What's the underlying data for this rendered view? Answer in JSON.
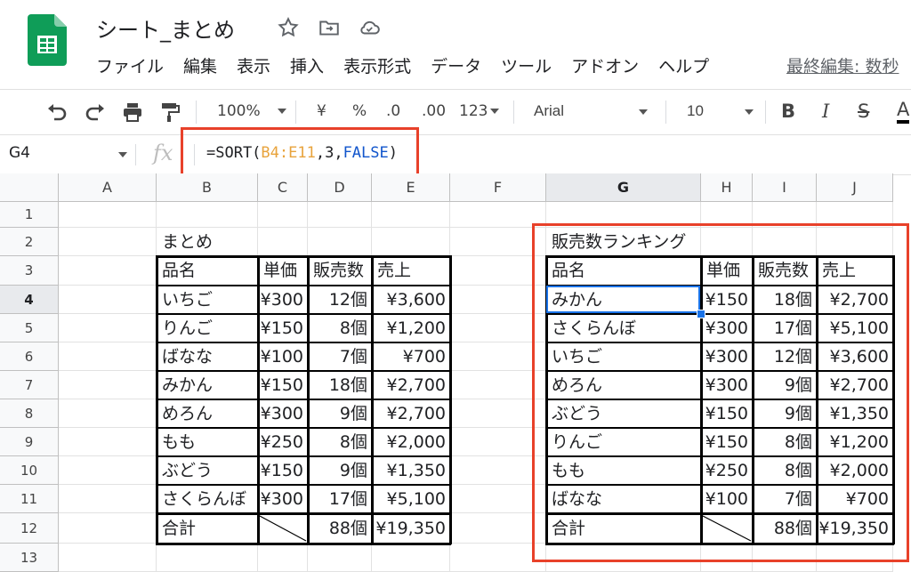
{
  "app": {
    "doc_title": "シート_まとめ",
    "last_edit": "最終編集: 数秒"
  },
  "colors": {
    "accent": "#1a73e8",
    "logo": "#0f9d58",
    "highlight": "#e8412a",
    "range": "#e8a33c",
    "keyword": "#1155cc"
  },
  "menu": [
    "ファイル",
    "編集",
    "表示",
    "挿入",
    "表示形式",
    "データ",
    "ツール",
    "アドオン",
    "ヘルプ"
  ],
  "toolbar": {
    "zoom": "100%",
    "currency": "¥",
    "percent": "%",
    "dec_less": ".0",
    "dec_more": ".00",
    "format_more": "123",
    "font": "Arial",
    "size": "10",
    "bold": "B",
    "italic": "I",
    "strike": "S",
    "text_color": "A"
  },
  "formula_bar": {
    "cell_ref": "G4",
    "fx": "fx",
    "parts": {
      "p1": "=SORT(",
      "range": "B4:E11",
      "p2": ",3,",
      "kw": "FALSE",
      "p3": ")"
    }
  },
  "columns": [
    "A",
    "B",
    "C",
    "D",
    "E",
    "F",
    "G",
    "H",
    "I",
    "J"
  ],
  "rows": [
    "1",
    "2",
    "3",
    "4",
    "5",
    "6",
    "7",
    "8",
    "9",
    "10",
    "11",
    "12",
    "13"
  ],
  "left_table": {
    "title": "まとめ",
    "headers": [
      "品名",
      "単価",
      "販売数",
      "売上"
    ],
    "rows": [
      [
        "いちご",
        "¥300",
        "12個",
        "¥3,600"
      ],
      [
        "りんご",
        "¥150",
        "8個",
        "¥1,200"
      ],
      [
        "ばなな",
        "¥100",
        "7個",
        "¥700"
      ],
      [
        "みかん",
        "¥150",
        "18個",
        "¥2,700"
      ],
      [
        "めろん",
        "¥300",
        "9個",
        "¥2,700"
      ],
      [
        "もも",
        "¥250",
        "8個",
        "¥2,000"
      ],
      [
        "ぶどう",
        "¥150",
        "9個",
        "¥1,350"
      ],
      [
        "さくらんぼ",
        "¥300",
        "17個",
        "¥5,100"
      ]
    ],
    "total": [
      "合計",
      "",
      "88個",
      "¥19,350"
    ]
  },
  "right_table": {
    "title": "販売数ランキング",
    "headers": [
      "品名",
      "単価",
      "販売数",
      "売上"
    ],
    "rows": [
      [
        "みかん",
        "¥150",
        "18個",
        "¥2,700"
      ],
      [
        "さくらんぼ",
        "¥300",
        "17個",
        "¥5,100"
      ],
      [
        "いちご",
        "¥300",
        "12個",
        "¥3,600"
      ],
      [
        "めろん",
        "¥300",
        "9個",
        "¥2,700"
      ],
      [
        "ぶどう",
        "¥150",
        "9個",
        "¥1,350"
      ],
      [
        "りんご",
        "¥150",
        "8個",
        "¥1,200"
      ],
      [
        "もも",
        "¥250",
        "8個",
        "¥2,000"
      ],
      [
        "ばなな",
        "¥100",
        "7個",
        "¥700"
      ]
    ],
    "total": [
      "合計",
      "",
      "88個",
      "¥19,350"
    ]
  }
}
